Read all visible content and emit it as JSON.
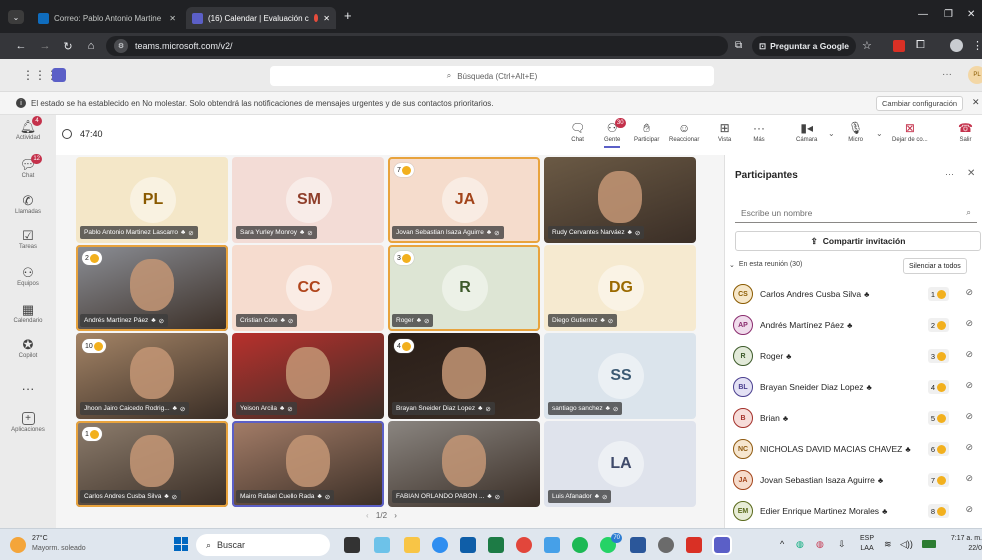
{
  "browser": {
    "tabs": [
      {
        "title": "Correo: Pablo Antonio Martine"
      },
      {
        "title": "(16) Calendar | Evaluación c"
      }
    ],
    "url": "teams.microsoft.com/v2/",
    "google_button": "Preguntar a Google"
  },
  "teams": {
    "search_placeholder": "Búsqueda (Ctrl+Alt+E)",
    "avatar_initials": "PL",
    "notice_text": "El estado se ha establecido en No molestar. Solo obtendrá las notificaciones de mensajes urgentes y de sus contactos prioritarios.",
    "notice_button": "Cambiar configuración",
    "rail": [
      {
        "label": "Actividad",
        "badge": "4"
      },
      {
        "label": "Chat",
        "badge": "12"
      },
      {
        "label": "Llamadas",
        "badge": ""
      },
      {
        "label": "Tareas",
        "badge": ""
      },
      {
        "label": "Equipos",
        "badge": ""
      },
      {
        "label": "Calendario",
        "badge": ""
      },
      {
        "label": "Copilot",
        "badge": ""
      },
      {
        "label": "Aplicaciones",
        "badge": ""
      }
    ]
  },
  "meeting": {
    "timer": "47:40",
    "toolbar": [
      {
        "label": "Chat",
        "badge": ""
      },
      {
        "label": "Gente",
        "badge": "30"
      },
      {
        "label": "Participar",
        "badge": ""
      },
      {
        "label": "Reaccionar",
        "badge": ""
      },
      {
        "label": "Vista",
        "badge": ""
      },
      {
        "label": "Más",
        "badge": ""
      },
      {
        "label": "Cámara",
        "badge": ""
      },
      {
        "label": "Micro",
        "badge": ""
      },
      {
        "label": "Dejar de co...",
        "badge": ""
      },
      {
        "label": "Salir",
        "badge": ""
      }
    ],
    "tiles": [
      {
        "name": "Pablo Antonio Martinez Lascarro",
        "initials": "PL",
        "hand": "",
        "border": "",
        "video": false,
        "color": "#f4e7c8",
        "fg": "#8a5a00"
      },
      {
        "name": "Sara Yurley Monroy",
        "initials": "SM",
        "hand": "",
        "border": "",
        "video": false,
        "color": "#f3dcd6",
        "fg": "#8f3e2a"
      },
      {
        "name": "Jovan Sebastian Isaza Aguirre",
        "initials": "JA",
        "hand": "7",
        "border": "orange",
        "video": false,
        "color": "#f5dccc",
        "fg": "#a3441a"
      },
      {
        "name": "Rudy Cervantes Narváez",
        "initials": "",
        "hand": "",
        "border": "",
        "video": true,
        "color": "#6b5a45",
        "fg": "#fff"
      },
      {
        "name": "Andrés Martínez Páez",
        "initials": "",
        "hand": "2",
        "border": "orange",
        "video": true,
        "color": "#8c8f96",
        "fg": "#fff"
      },
      {
        "name": "Cristian Cote",
        "initials": "CC",
        "hand": "",
        "border": "",
        "video": false,
        "color": "#f6dccf",
        "fg": "#b0451c"
      },
      {
        "name": "Roger",
        "initials": "R",
        "hand": "3",
        "border": "orange",
        "video": false,
        "color": "#dde5d4",
        "fg": "#3d5a2a"
      },
      {
        "name": "Diego Gutierrez",
        "initials": "DG",
        "hand": "",
        "border": "",
        "video": false,
        "color": "#f6ead0",
        "fg": "#9b6a00"
      },
      {
        "name": "Jhoon Jairo Caicedo Rodrig...",
        "initials": "",
        "hand": "10",
        "border": "",
        "video": true,
        "color": "#a48466",
        "fg": "#fff"
      },
      {
        "name": "Yeison Arcila",
        "initials": "",
        "hand": "",
        "border": "",
        "video": true,
        "color": "#b8302d",
        "fg": "#fff"
      },
      {
        "name": "Brayan Sneider Diaz Lopez",
        "initials": "",
        "hand": "4",
        "border": "",
        "video": true,
        "color": "#2a1e18",
        "fg": "#fff"
      },
      {
        "name": "santiago sanchez",
        "initials": "SS",
        "hand": "",
        "border": "",
        "video": false,
        "color": "#dbe4ec",
        "fg": "#3c5a73"
      },
      {
        "name": "Carlos Andres Cusba Silva",
        "initials": "",
        "hand": "1",
        "border": "orange",
        "video": true,
        "color": "#8d7d6d",
        "fg": "#fff"
      },
      {
        "name": "Mairo Rafael Cuello Rada",
        "initials": "",
        "hand": "",
        "border": "blue",
        "video": true,
        "color": "#a47d68",
        "fg": "#fff"
      },
      {
        "name": "FABIAN ORLANDO PABON ...",
        "initials": "",
        "hand": "",
        "border": "",
        "video": true,
        "color": "#8a8580",
        "fg": "#fff"
      },
      {
        "name": "Luis Afanador",
        "initials": "LA",
        "hand": "",
        "border": "",
        "video": false,
        "color": "#dfe3ec",
        "fg": "#3f4a6a"
      }
    ],
    "pager": "1/2"
  },
  "panel": {
    "title": "Participantes",
    "search_placeholder": "Escribe un nombre",
    "invite_button": "Compartir invitación",
    "section_label": "En esta reunión (30)",
    "mute_all": "Silenciar a todos",
    "participants": [
      {
        "initials": "CS",
        "name": "Carlos Andres Cusba Silva",
        "hand": "1",
        "bg": "#f6e7c9",
        "fg": "#8a5a00"
      },
      {
        "initials": "AP",
        "name": "Andrés Martínez Páez",
        "hand": "2",
        "bg": "#f0dcec",
        "fg": "#8a2c6e"
      },
      {
        "initials": "R",
        "name": "Roger",
        "hand": "3",
        "bg": "#e2ead9",
        "fg": "#3d5a2a"
      },
      {
        "initials": "BL",
        "name": "Brayan Sneider Diaz Lopez",
        "hand": "4",
        "bg": "#e3e1f4",
        "fg": "#4a3f8f"
      },
      {
        "initials": "B",
        "name": "Brian",
        "hand": "5",
        "bg": "#f6dcd9",
        "fg": "#a3302a"
      },
      {
        "initials": "NC",
        "name": "NICHOLAS DAVID MACIAS CHAVEZ",
        "hand": "6",
        "bg": "#f6e6cf",
        "fg": "#8f5a10"
      },
      {
        "initials": "JA",
        "name": "Jovan Sebastian Isaza Aguirre",
        "hand": "7",
        "bg": "#f6dccc",
        "fg": "#a3441a"
      },
      {
        "initials": "EM",
        "name": "Edier Enrique Martinez Morales",
        "hand": "8",
        "bg": "#e7ecd6",
        "fg": "#5a6a1c"
      }
    ]
  },
  "taskbar": {
    "weather_temp": "27°C",
    "weather_desc": "Mayorm. soleado",
    "search_label": "Buscar",
    "lang1": "ESP",
    "lang2": "LAA",
    "time": "7:17 a. m.",
    "date": "22/0",
    "badge": "70"
  }
}
